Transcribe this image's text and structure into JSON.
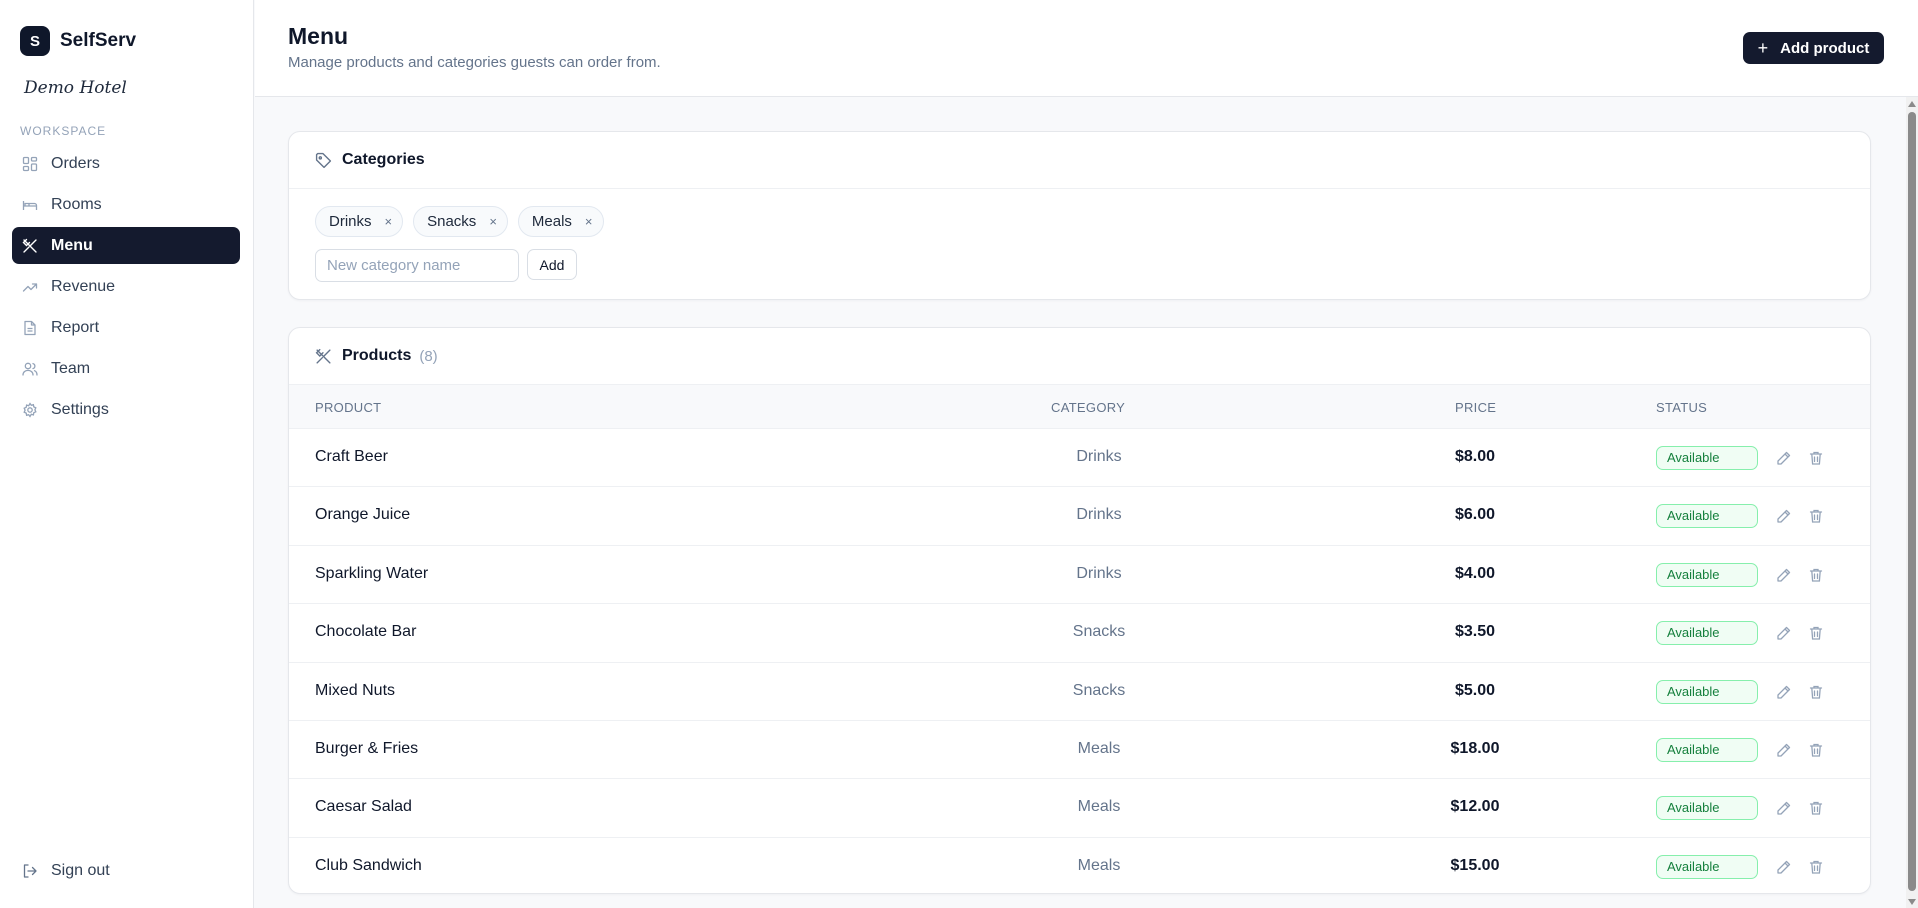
{
  "brand": {
    "logo_letter": "S",
    "name": "SelfServ",
    "hotel": "Demo Hotel"
  },
  "sidebar": {
    "section": "WORKSPACE",
    "items": [
      {
        "label": "Orders",
        "icon": "grid-icon"
      },
      {
        "label": "Rooms",
        "icon": "bed-icon"
      },
      {
        "label": "Menu",
        "icon": "utensils-icon",
        "active": true
      },
      {
        "label": "Revenue",
        "icon": "trending-up-icon"
      },
      {
        "label": "Report",
        "icon": "document-icon"
      },
      {
        "label": "Team",
        "icon": "users-icon"
      },
      {
        "label": "Settings",
        "icon": "gear-icon"
      }
    ],
    "signout": "Sign out"
  },
  "header": {
    "title": "Menu",
    "subtitle": "Manage products and categories guests can order from.",
    "add_button": "Add product",
    "add_button_icon": "+"
  },
  "categories": {
    "title": "Categories",
    "chips": [
      "Drinks",
      "Snacks",
      "Meals"
    ],
    "remove_glyph": "×",
    "input_placeholder": "New category name",
    "input_value": "",
    "add_label": "Add"
  },
  "products": {
    "title": "Products",
    "count": "(8)",
    "columns": {
      "product": "PRODUCT",
      "category": "CATEGORY",
      "price": "PRICE",
      "status": "STATUS"
    },
    "rows": [
      {
        "name": "Craft Beer",
        "category": "Drinks",
        "price": "$8.00",
        "status": "Available"
      },
      {
        "name": "Orange Juice",
        "category": "Drinks",
        "price": "$6.00",
        "status": "Available"
      },
      {
        "name": "Sparkling Water",
        "category": "Drinks",
        "price": "$4.00",
        "status": "Available"
      },
      {
        "name": "Chocolate Bar",
        "category": "Snacks",
        "price": "$3.50",
        "status": "Available"
      },
      {
        "name": "Mixed Nuts",
        "category": "Snacks",
        "price": "$5.00",
        "status": "Available"
      },
      {
        "name": "Burger & Fries",
        "category": "Meals",
        "price": "$18.00",
        "status": "Available"
      },
      {
        "name": "Caesar Salad",
        "category": "Meals",
        "price": "$12.00",
        "status": "Available"
      },
      {
        "name": "Club Sandwich",
        "category": "Meals",
        "price": "$15.00",
        "status": "Available"
      }
    ]
  },
  "colors": {
    "primary": "#141a2e",
    "status_green": "#15803d",
    "muted": "#64748b"
  }
}
